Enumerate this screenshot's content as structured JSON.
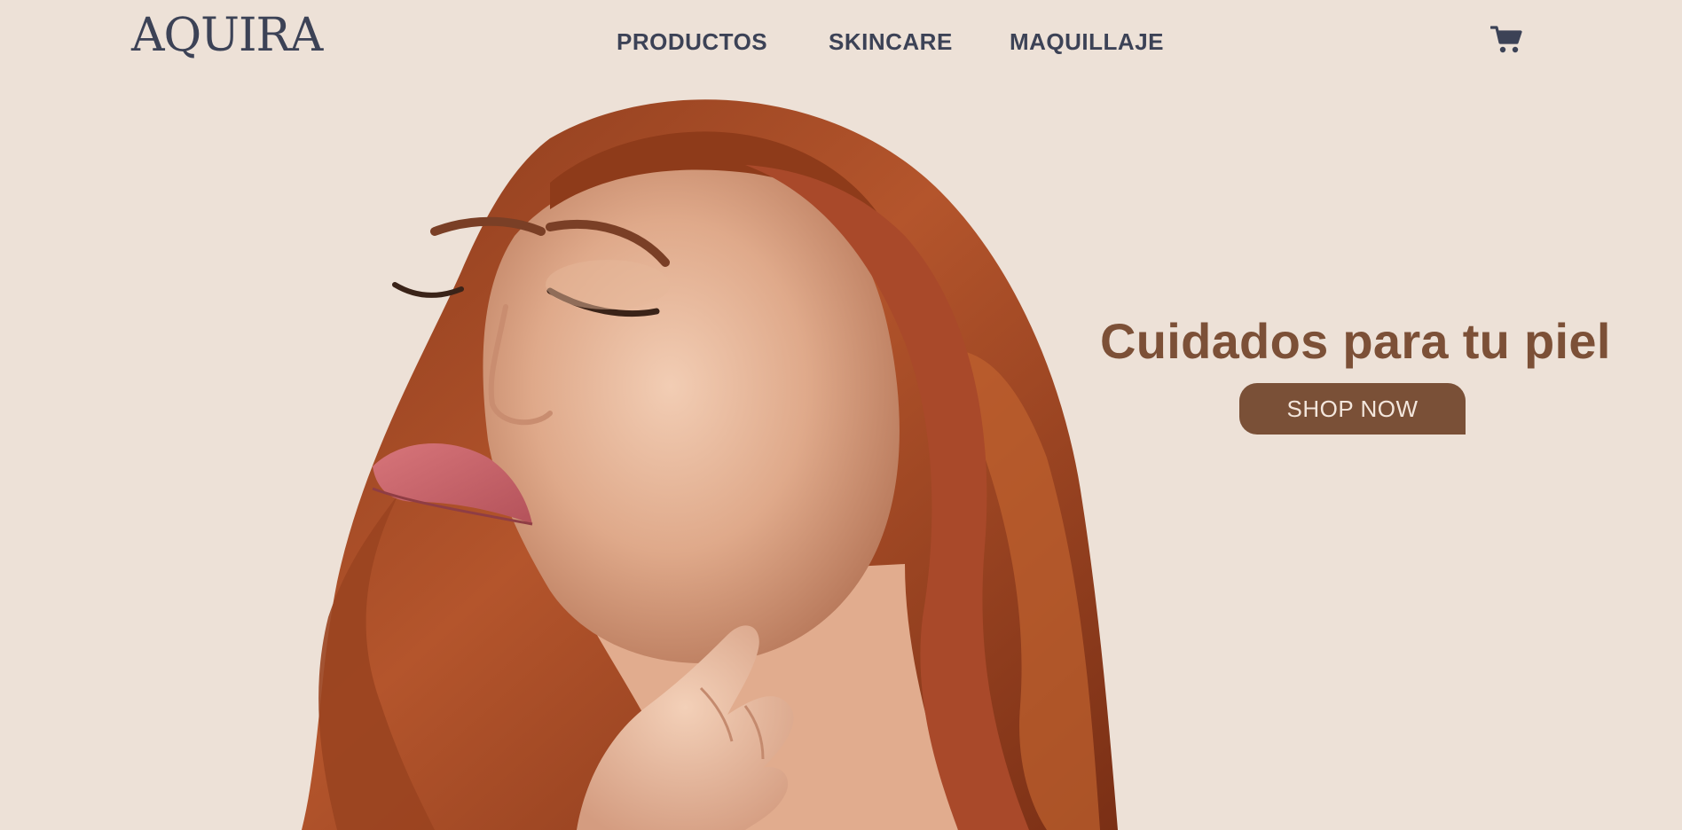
{
  "brand": {
    "logo_text": "AQUIRA"
  },
  "nav": {
    "items": [
      {
        "label": "PRODUCTOS"
      },
      {
        "label": "SKINCARE"
      },
      {
        "label": "MAQUILLAJE"
      }
    ],
    "cart_icon": "shopping-cart-icon"
  },
  "hero": {
    "headline": "Cuidados para tu piel",
    "cta_label": "SHOP NOW",
    "image": "portrait of woman with auburn wavy hair, eyes closed, hand on neck"
  },
  "colors": {
    "background": "#ede1d7",
    "nav_text": "#3c4256",
    "accent_brown": "#7a5037",
    "button_text": "#f3e6dc"
  }
}
